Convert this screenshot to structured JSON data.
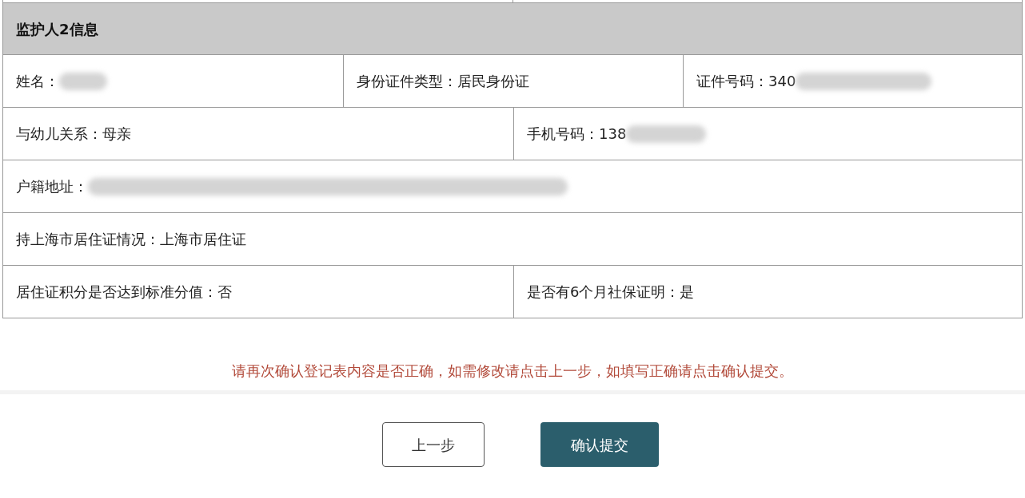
{
  "section": {
    "title": "监护人2信息"
  },
  "rows": [
    {
      "cells": [
        {
          "text": "姓名：",
          "redacted": true
        },
        {
          "text": "身份证件类型：居民身份证",
          "redacted": false
        },
        {
          "text": "证件号码：340",
          "redacted": true
        }
      ]
    },
    {
      "cells": [
        {
          "text": "与幼儿关系：母亲",
          "redacted": false
        },
        {
          "text": "手机号码：138",
          "redacted": true
        }
      ]
    },
    {
      "cells": [
        {
          "text": "户籍地址：",
          "redacted": true
        }
      ]
    },
    {
      "cells": [
        {
          "text": "持上海市居住证情况：上海市居住证",
          "redacted": false
        }
      ]
    },
    {
      "cells": [
        {
          "text": "居住证积分是否达到标准分值：否",
          "redacted": false
        },
        {
          "text": "是否有6个月社保证明：是",
          "redacted": false
        }
      ]
    }
  ],
  "notice": "请再次确认登记表内容是否正确，如需修改请点击上一步，如填写正确请点击确认提交。",
  "buttons": [
    {
      "label": "上一步",
      "kind": "secondary"
    },
    {
      "label": "确认提交",
      "kind": "primary"
    }
  ]
}
